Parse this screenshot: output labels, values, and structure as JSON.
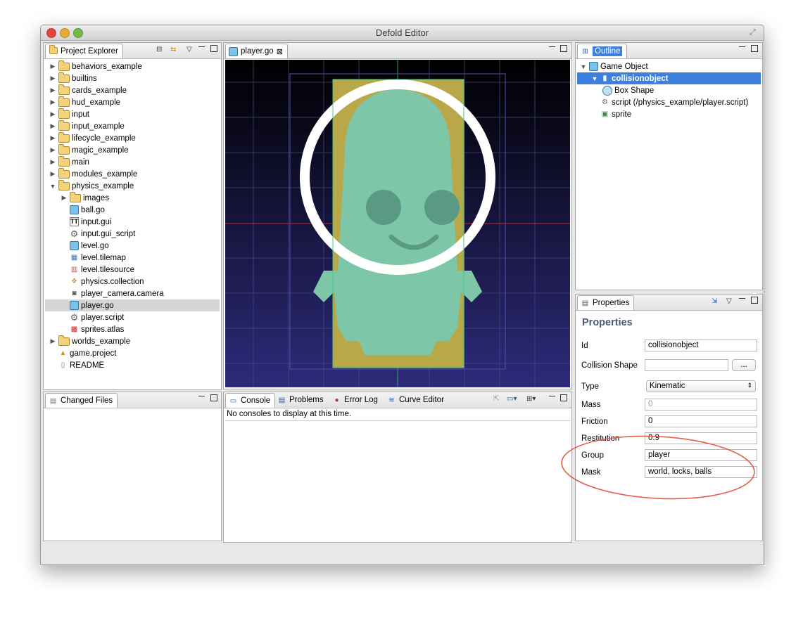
{
  "window": {
    "title": "Defold Editor"
  },
  "project_explorer": {
    "tab_label": "Project Explorer",
    "items": [
      {
        "label": "behaviors_example",
        "type": "folder",
        "expanded": false,
        "level": 0
      },
      {
        "label": "builtins",
        "type": "folder",
        "expanded": false,
        "level": 0
      },
      {
        "label": "cards_example",
        "type": "folder",
        "expanded": false,
        "level": 0
      },
      {
        "label": "hud_example",
        "type": "folder",
        "expanded": false,
        "level": 0
      },
      {
        "label": "input",
        "type": "folder",
        "expanded": false,
        "level": 0
      },
      {
        "label": "input_example",
        "type": "folder",
        "expanded": false,
        "level": 0
      },
      {
        "label": "lifecycle_example",
        "type": "folder",
        "expanded": false,
        "level": 0
      },
      {
        "label": "magic_example",
        "type": "folder",
        "expanded": false,
        "level": 0
      },
      {
        "label": "main",
        "type": "folder",
        "expanded": false,
        "level": 0
      },
      {
        "label": "modules_example",
        "type": "folder",
        "expanded": false,
        "level": 0
      },
      {
        "label": "physics_example",
        "type": "folder",
        "expanded": true,
        "level": 0
      },
      {
        "label": "images",
        "type": "folder",
        "expanded": false,
        "level": 1
      },
      {
        "label": "ball.go",
        "type": "gameobject",
        "level": 1
      },
      {
        "label": "input.gui",
        "type": "gui",
        "level": 1
      },
      {
        "label": "input.gui_script",
        "type": "script",
        "level": 1
      },
      {
        "label": "level.go",
        "type": "gameobject",
        "level": 1
      },
      {
        "label": "level.tilemap",
        "type": "tilemap",
        "level": 1
      },
      {
        "label": "level.tilesource",
        "type": "tilesource",
        "level": 1
      },
      {
        "label": "physics.collection",
        "type": "collection",
        "level": 1
      },
      {
        "label": "player_camera.camera",
        "type": "camera",
        "level": 1
      },
      {
        "label": "player.go",
        "type": "gameobject",
        "level": 1,
        "selected": true
      },
      {
        "label": "player.script",
        "type": "script",
        "level": 1
      },
      {
        "label": "sprites.atlas",
        "type": "atlas",
        "level": 1
      },
      {
        "label": "worlds_example",
        "type": "folder",
        "expanded": false,
        "level": 0
      },
      {
        "label": "game.project",
        "type": "project",
        "level": 0
      },
      {
        "label": "README",
        "type": "file",
        "level": 0
      }
    ]
  },
  "changed_files": {
    "tab_label": "Changed Files"
  },
  "editor": {
    "tab_label": "player.go",
    "close_glyph": "⊠"
  },
  "console": {
    "tabs": [
      {
        "label": "Console"
      },
      {
        "label": "Problems"
      },
      {
        "label": "Error Log"
      },
      {
        "label": "Curve Editor"
      }
    ],
    "message": "No consoles to display at this time."
  },
  "outline": {
    "tab_label": "Outline",
    "items": [
      {
        "label": "Game Object",
        "level": 0,
        "icon": "cube-icon"
      },
      {
        "label": "collisionobject",
        "level": 1,
        "icon": "collision-icon",
        "selected": true
      },
      {
        "label": "Box Shape",
        "level": 2,
        "icon": "circle-icon"
      },
      {
        "label": "script (/physics_example/player.script)",
        "level": 1,
        "icon": "gear-icon"
      },
      {
        "label": "sprite",
        "level": 1,
        "icon": "sprite-icon"
      }
    ]
  },
  "properties": {
    "tab_label": "Properties",
    "heading": "Properties",
    "fields": {
      "id": {
        "label": "Id",
        "value": "collisionobject"
      },
      "collision_shape": {
        "label": "Collision Shape",
        "value": "",
        "button": "..."
      },
      "type": {
        "label": "Type",
        "value": "Kinematic"
      },
      "mass": {
        "label": "Mass",
        "value": "0"
      },
      "friction": {
        "label": "Friction",
        "value": "0"
      },
      "restitution": {
        "label": "Restitution",
        "value": "0.9"
      },
      "group": {
        "label": "Group",
        "value": "player"
      },
      "mask": {
        "label": "Mask",
        "value": "world, locks, balls"
      }
    }
  },
  "colors": {
    "selection": "#3d80df",
    "annotation": "#e0604a",
    "viewport_top": "#000000",
    "viewport_bottom": "#2d2a7a"
  }
}
